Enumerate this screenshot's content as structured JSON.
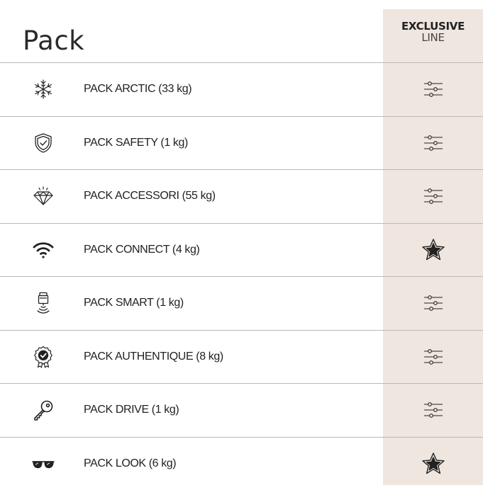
{
  "header": {
    "title": "Pack",
    "column_line1": "EXCLUSIVE",
    "column_line2": "LINE"
  },
  "rows": [
    {
      "label": "PACK ARCTIC (33 kg)",
      "icon": "snowflake-icon",
      "mark": "sliders-icon"
    },
    {
      "label": "PACK SAFETY (1 kg)",
      "icon": "shield-check-icon",
      "mark": "sliders-icon"
    },
    {
      "label": "PACK ACCESSORI (55 kg)",
      "icon": "diamond-icon",
      "mark": "sliders-icon"
    },
    {
      "label": "PACK CONNECT (4 kg)",
      "icon": "wifi-icon",
      "mark": "star-icon"
    },
    {
      "label": "PACK SMART (1 kg)",
      "icon": "smart-device-icon",
      "mark": "sliders-icon"
    },
    {
      "label": "PACK AUTHENTIQUE (8 kg)",
      "icon": "badge-check-icon",
      "mark": "sliders-icon"
    },
    {
      "label": "PACK DRIVE (1 kg)",
      "icon": "key-icon",
      "mark": "sliders-icon"
    },
    {
      "label": "PACK LOOK (6 kg)",
      "icon": "sunglasses-icon",
      "mark": "star-icon"
    }
  ],
  "colors": {
    "column_bg": "#efe6df",
    "divider": "#b8b8b8",
    "text": "#222222"
  }
}
